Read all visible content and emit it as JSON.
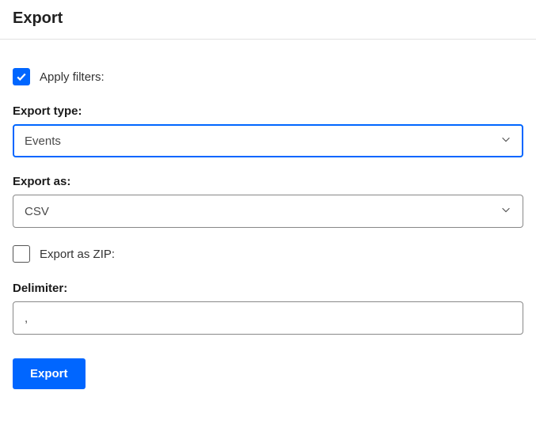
{
  "header": {
    "title": "Export"
  },
  "applyFilters": {
    "label": "Apply filters:",
    "checked": true
  },
  "exportType": {
    "label": "Export type:",
    "value": "Events"
  },
  "exportAs": {
    "label": "Export as:",
    "value": "CSV"
  },
  "exportZip": {
    "label": "Export as ZIP:",
    "checked": false
  },
  "delimiter": {
    "label": "Delimiter:",
    "value": ","
  },
  "actions": {
    "export": "Export"
  }
}
